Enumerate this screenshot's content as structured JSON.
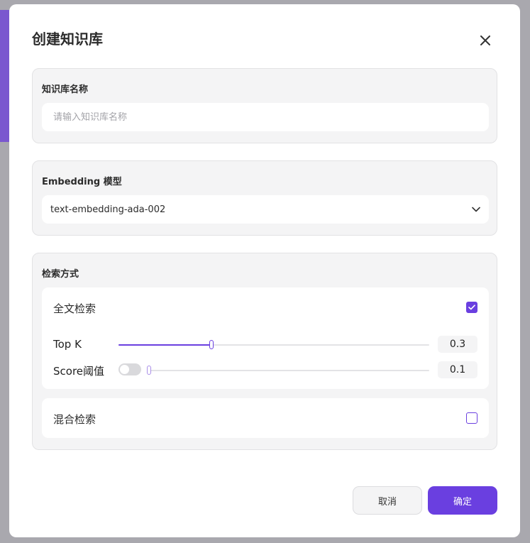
{
  "colors": {
    "accent": "#6a3fe0",
    "backdrop": "#a9a8ae",
    "section_bg": "#f4f4f5"
  },
  "modal": {
    "title": "创建知识库",
    "close_icon": "close-icon"
  },
  "kb_name": {
    "label": "知识库名称",
    "placeholder": "请输入知识库名称",
    "value": ""
  },
  "embedding": {
    "label": "Embedding 模型",
    "selected": "text-embedding-ada-002",
    "icon": "chevron-down-icon"
  },
  "retrieval": {
    "label": "检索方式",
    "fulltext": {
      "label": "全文检索",
      "checked": true,
      "top_k": {
        "label": "Top K",
        "value": "0.3",
        "fraction": 0.3
      },
      "score": {
        "label": "Score阈值",
        "value": "0.1",
        "fraction": 0.0,
        "toggle_on": false
      }
    },
    "hybrid": {
      "label": "混合检索",
      "checked": false
    }
  },
  "footer": {
    "cancel_label": "取消",
    "confirm_label": "确定"
  }
}
